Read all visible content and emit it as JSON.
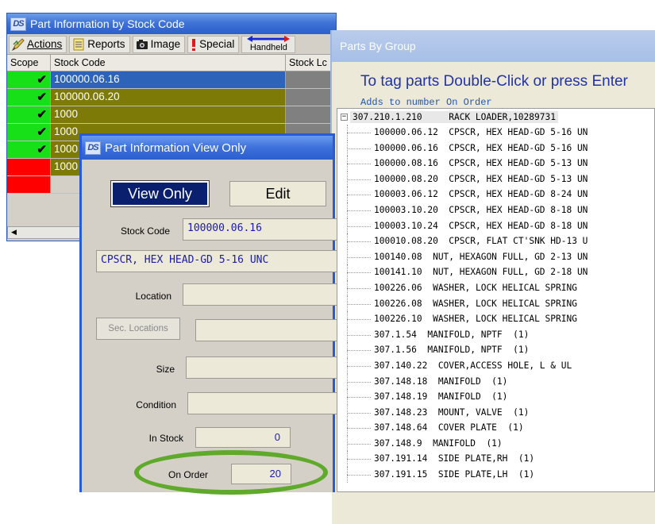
{
  "back_window": {
    "title": "Part Information by Stock Code",
    "logo": "DS",
    "toolbar": [
      {
        "label": "Actions",
        "icon": "pencil-icon"
      },
      {
        "label": "Reports",
        "icon": "document-icon"
      },
      {
        "label": "Image",
        "icon": "camera-icon"
      },
      {
        "label": "Special",
        "icon": "exclamation-icon"
      },
      {
        "label": "Handheld",
        "icon": "arrows-icon"
      }
    ],
    "columns": [
      "Scope",
      "Stock Code",
      "Stock Lc"
    ],
    "rows": [
      {
        "stock_code": "100000.06.16",
        "checked": true,
        "scope_color": "#18e018",
        "row_color": "#2d63b8"
      },
      {
        "stock_code": "100000.06.20",
        "checked": true,
        "scope_color": "#18e018",
        "row_color": "#7e7a08"
      },
      {
        "stock_code": "1000",
        "checked": true,
        "scope_color": "#18e018",
        "row_color": "#7e7a08"
      },
      {
        "stock_code": "1000",
        "checked": true,
        "scope_color": "#18e018",
        "row_color": "#7e7a08"
      },
      {
        "stock_code": "1000",
        "checked": true,
        "scope_color": "#18e018",
        "row_color": "#7e7a08"
      },
      {
        "stock_code": "1000",
        "checked": false,
        "scope_color": "#ff0000",
        "row_color": "#7e7a08"
      },
      {
        "stock_code": "",
        "checked": false,
        "scope_color": "#ff0000",
        "row_color": "#d4d0c8"
      }
    ]
  },
  "parts_window": {
    "title": "Parts By Group",
    "hint": "To tag parts Double-Click or press Enter",
    "subhint": "Adds to number On Order",
    "root": "307.210.1.210     RACK LOADER,10289731",
    "items": [
      "100000.06.12  CPSCR, HEX HEAD-GD 5-16 UN",
      "100000.06.16  CPSCR, HEX HEAD-GD 5-16 UN",
      "100000.08.16  CPSCR, HEX HEAD-GD 5-13 UN",
      "100000.08.20  CPSCR, HEX HEAD-GD 5-13 UN",
      "100003.06.12  CPSCR, HEX HEAD-GD 8-24 UN",
      "100003.10.20  CPSCR, HEX HEAD-GD 8-18 UN",
      "100003.10.24  CPSCR, HEX HEAD-GD 8-18 UN",
      "100010.08.20  CPSCR, FLAT CT'SNK HD-13 U",
      "100140.08  NUT, HEXAGON FULL, GD 2-13 UN",
      "100141.10  NUT, HEXAGON FULL, GD 2-18 UN",
      "100226.06  WASHER, LOCK HELICAL SPRING",
      "100226.08  WASHER, LOCK HELICAL SPRING",
      "100226.10  WASHER, LOCK HELICAL SPRING",
      "307.1.54  MANIFOLD, NPTF  (1)",
      "307.1.56  MANIFOLD, NPTF  (1)",
      "307.140.22  COVER,ACCESS HOLE, L & UL",
      "307.148.18  MANIFOLD  (1)",
      "307.148.19  MANIFOLD  (1)",
      "307.148.23  MOUNT, VALVE  (1)",
      "307.148.64  COVER PLATE  (1)",
      "307.148.9  MANIFOLD  (1)",
      "307.191.14  SIDE PLATE,RH  (1)",
      "307.191.15  SIDE PLATE,LH  (1)"
    ]
  },
  "view_window": {
    "title": "Part Information View Only",
    "logo": "DS",
    "tabs": {
      "view_only": "View Only",
      "edit": "Edit"
    },
    "stock_code_label": "Stock Code",
    "stock_code": "100000.06.16",
    "description": "CPSCR, HEX HEAD-GD 5-16 UNC",
    "location_label": "Location",
    "location": "",
    "sec_locations_label": "Sec. Locations",
    "sec_locations": "",
    "size_label": "Size",
    "size": "",
    "condition_label": "Condition",
    "condition": "",
    "in_stock_label": "In Stock",
    "in_stock": "0",
    "on_order_label": "On Order",
    "on_order": "20"
  },
  "colors": {
    "active_tab": "#0a1f6e",
    "highlight": "#5faa2a"
  }
}
